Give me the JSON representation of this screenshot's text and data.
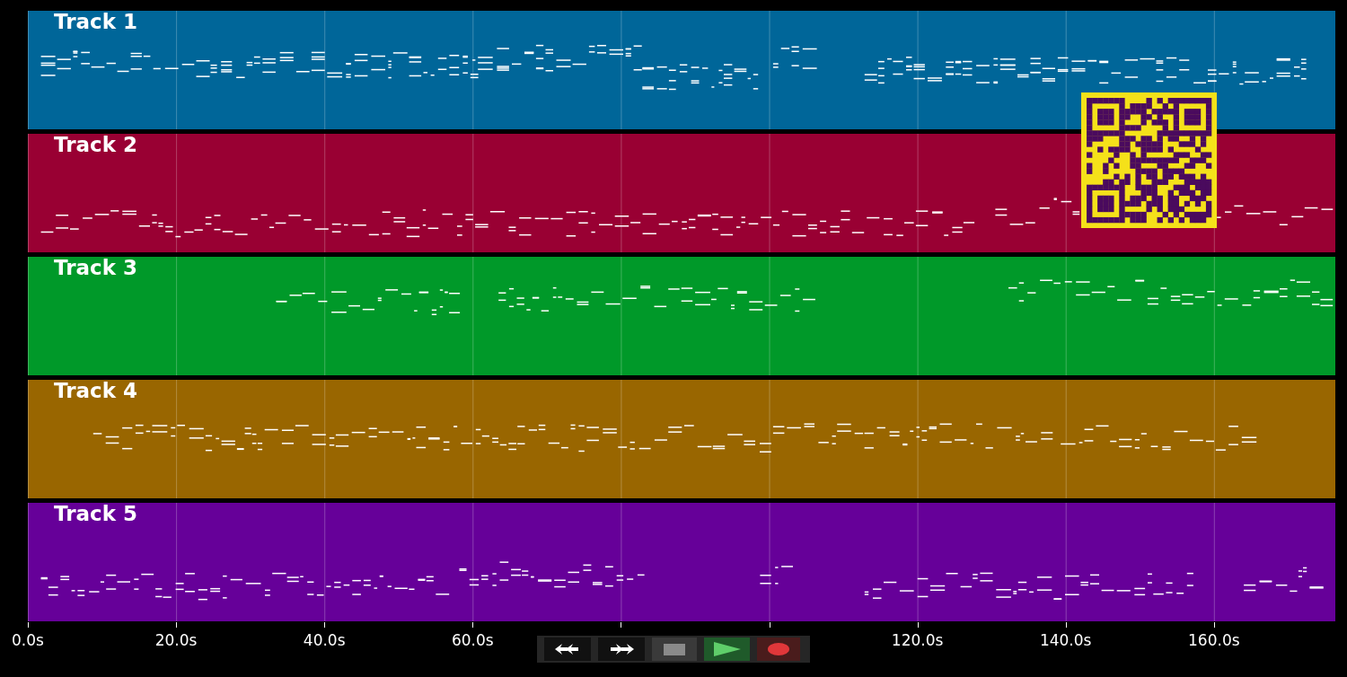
{
  "tracks": [
    {
      "name": "Track 1",
      "color": "#006699"
    },
    {
      "name": "Track 2",
      "color": "#990033"
    },
    {
      "name": "Track 3",
      "color": "#009929"
    },
    {
      "name": "Track 4",
      "color": "#996600"
    },
    {
      "name": "Track 5",
      "color": "#660099"
    }
  ],
  "time_axis": {
    "left_labels": [
      "0.0s",
      "20.0s",
      "40.0s",
      "60.0s"
    ],
    "right_labels": [
      "120.0s",
      "140.0s",
      "160.0s"
    ]
  },
  "transport": [
    {
      "kind": "rewind"
    },
    {
      "kind": "forward"
    },
    {
      "kind": "stop"
    },
    {
      "kind": "play"
    },
    {
      "kind": "record"
    }
  ]
}
